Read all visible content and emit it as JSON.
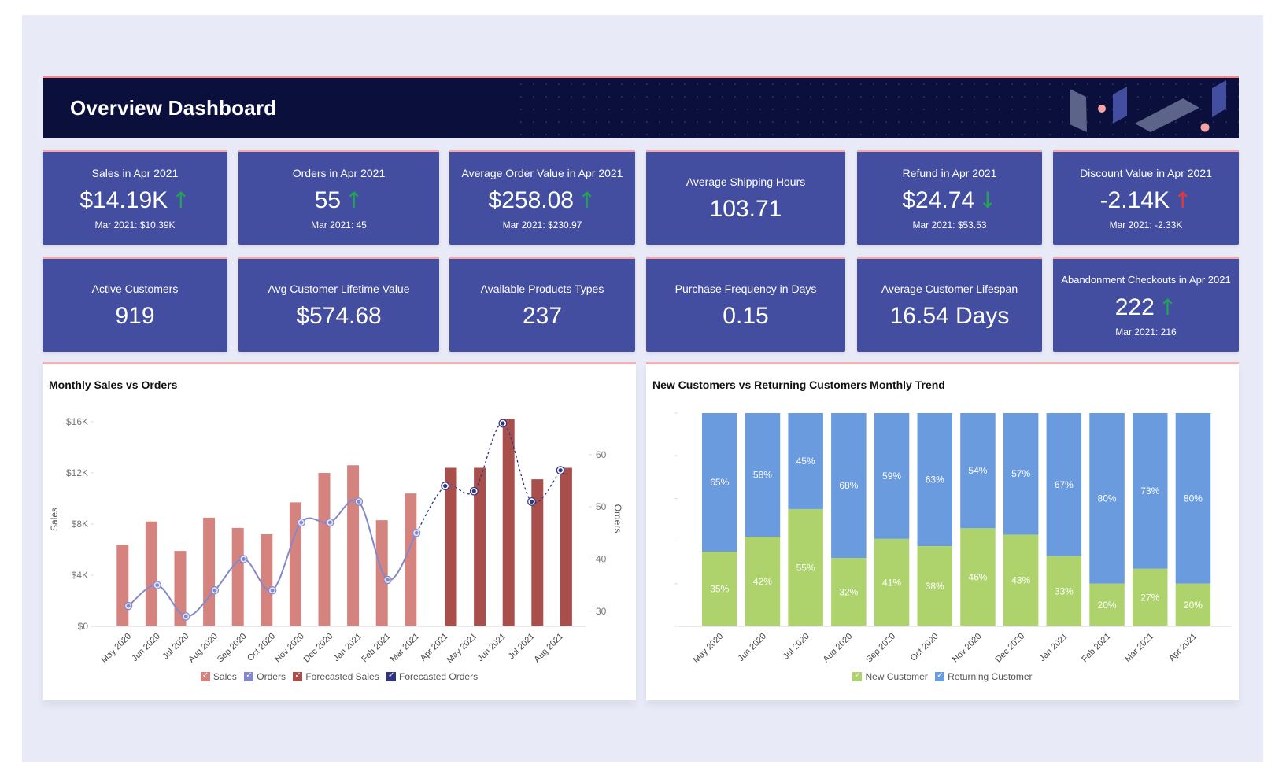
{
  "theme": {
    "page_bg": "#E9EAF7",
    "header_bg": "#0B0F3B",
    "header_stripe": "#F38A8E",
    "card_bg": "#434EA0",
    "card_stripe": "#F4A9A8",
    "trend_good": "#1FA64F",
    "trend_bad": "#E53935"
  },
  "header": {
    "title": "Overview Dashboard"
  },
  "kpis": [
    {
      "label": "Sales in Apr 2021",
      "value": "$14.19K",
      "trend": {
        "direction": "up",
        "glyph": "↑",
        "color": "#1FA64F"
      },
      "comparison": "Mar 2021: $10.39K"
    },
    {
      "label": "Orders in Apr 2021",
      "value": "55",
      "trend": {
        "direction": "up",
        "glyph": "↑",
        "color": "#1FA64F"
      },
      "comparison": "Mar 2021: 45"
    },
    {
      "label": "Average Order Value in Apr 2021",
      "value": "$258.08",
      "trend": {
        "direction": "up",
        "glyph": "↑",
        "color": "#1FA64F"
      },
      "comparison": "Mar 2021: $230.97"
    },
    {
      "label": "Average Shipping Hours",
      "value": "103.71"
    },
    {
      "label": "Refund in Apr 2021",
      "value": "$24.74",
      "trend": {
        "direction": "down",
        "glyph": "↓",
        "color": "#1FA64F"
      },
      "comparison": "Mar 2021: $53.53"
    },
    {
      "label": "Discount Value in Apr 2021",
      "value": "-2.14K",
      "trend": {
        "direction": "up",
        "glyph": "↑",
        "color": "#E53935"
      },
      "comparison": "Mar 2021: -2.33K"
    },
    {
      "label": "Active Customers",
      "value": "919"
    },
    {
      "label": "Avg Customer Lifetime Value",
      "value": "$574.68"
    },
    {
      "label": "Available Products Types",
      "value": "237"
    },
    {
      "label": "Purchase Frequency in Days",
      "value": "0.15"
    },
    {
      "label": "Average Customer Lifespan",
      "value": "16.54 Days"
    },
    {
      "label": "Abandonment Checkouts in Apr 2021",
      "value": "222",
      "trend": {
        "direction": "up",
        "glyph": "↑",
        "color": "#1FA64F"
      },
      "comparison": "Mar 2021: 216"
    }
  ],
  "chart_data": [
    {
      "type": "bar+line",
      "title": "Monthly Sales vs Orders",
      "xlabel": "",
      "ylabel": "Sales",
      "y2label": "Orders",
      "y_units": "thousands USD",
      "ylim": [
        0,
        16
      ],
      "yticks": [
        {
          "value": 0,
          "label": "$0"
        },
        {
          "value": 4,
          "label": "$4K"
        },
        {
          "value": 8,
          "label": "$8K"
        },
        {
          "value": 12,
          "label": "$12K"
        },
        {
          "value": 16,
          "label": "$16K"
        }
      ],
      "y2lim": [
        27.1,
        66.3
      ],
      "y2ticks": [
        {
          "value": 30,
          "label": "30"
        },
        {
          "value": 40,
          "label": "40"
        },
        {
          "value": 50,
          "label": "50"
        },
        {
          "value": 60,
          "label": "60"
        }
      ],
      "grid": false,
      "legend": "bottom",
      "categories": [
        "May 2020",
        "Jun 2020",
        "Jul 2020",
        "Aug 2020",
        "Sep 2020",
        "Oct 2020",
        "Nov 2020",
        "Dec 2020",
        "Jan 2021",
        "Feb 2021",
        "Mar 2021",
        "Apr 2021",
        "May 2021",
        "Jun 2021",
        "Jul 2021",
        "Aug 2021"
      ],
      "series": [
        {
          "name": "Sales",
          "type": "bar",
          "axis": "left",
          "forecast": false,
          "color": "#D4837F",
          "values": [
            6.4,
            8.2,
            5.9,
            8.5,
            7.7,
            7.2,
            9.7,
            12.0,
            12.6,
            8.3,
            10.39,
            null,
            null,
            null,
            null,
            null
          ]
        },
        {
          "name": "Orders",
          "type": "line",
          "axis": "right",
          "forecast": false,
          "color": "#8388CB",
          "values": [
            31,
            35,
            29,
            34,
            40,
            34,
            47,
            47,
            51,
            36,
            45,
            null,
            null,
            null,
            null,
            null
          ]
        },
        {
          "name": "Forecasted Sales",
          "type": "bar",
          "axis": "left",
          "forecast": true,
          "color": "#A84F4C",
          "values": [
            null,
            null,
            null,
            null,
            null,
            null,
            null,
            null,
            null,
            null,
            null,
            12.4,
            12.4,
            16.2,
            11.5,
            12.4
          ]
        },
        {
          "name": "Forecasted Orders",
          "type": "line",
          "axis": "right",
          "forecast": true,
          "dashed": true,
          "color": "#2F3483",
          "values": [
            null,
            null,
            null,
            null,
            null,
            null,
            null,
            null,
            null,
            null,
            null,
            54,
            53,
            66,
            51,
            57
          ]
        }
      ]
    },
    {
      "type": "bar",
      "stacked": "percent",
      "title": "New Customers vs Returning Customers Monthly Trend",
      "xlabel": "",
      "ylabel": "",
      "ylim": [
        0,
        100
      ],
      "ytick_values": [
        0,
        20,
        40,
        60,
        80,
        100
      ],
      "grid": false,
      "legend": "bottom",
      "categories": [
        "May 2020",
        "Jun 2020",
        "Jul 2020",
        "Aug 2020",
        "Sep 2020",
        "Oct 2020",
        "Nov 2020",
        "Dec 2020",
        "Jan 2021",
        "Feb 2021",
        "Mar 2021",
        "Apr 2021"
      ],
      "series": [
        {
          "name": "New Customer",
          "color": "#AED36C",
          "values": [
            35,
            42,
            55,
            32,
            41,
            38,
            46,
            43,
            33,
            20,
            27,
            20
          ],
          "data_labels": [
            "35%",
            "42%",
            "55%",
            "32%",
            "41%",
            "38%",
            "46%",
            "43%",
            "33%",
            "20%",
            "27%",
            "20%"
          ]
        },
        {
          "name": "Returning Customer",
          "color": "#6A9BDE",
          "values": [
            65,
            58,
            45,
            68,
            59,
            63,
            54,
            57,
            67,
            80,
            73,
            80
          ],
          "data_labels": [
            "65%",
            "58%",
            "45%",
            "68%",
            "59%",
            "63%",
            "54%",
            "57%",
            "67%",
            "80%",
            "73%",
            "80%"
          ]
        }
      ]
    }
  ]
}
